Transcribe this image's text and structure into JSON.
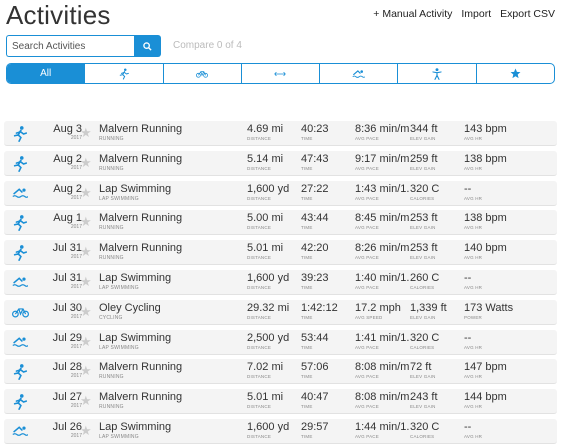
{
  "header": {
    "title": "Activities",
    "manual_activity": "+ Manual Activity",
    "import": "Import",
    "export": "Export CSV"
  },
  "search": {
    "placeholder": "Search Activities",
    "compare": "Compare 0 of 4"
  },
  "filters": [
    {
      "label": "All",
      "icon": "all"
    },
    {
      "label": "",
      "icon": "running-icon"
    },
    {
      "label": "",
      "icon": "cycling-icon"
    },
    {
      "label": "",
      "icon": "arrows-icon"
    },
    {
      "label": "",
      "icon": "swimming-icon"
    },
    {
      "label": "",
      "icon": "person-icon"
    },
    {
      "label": "",
      "icon": "star-icon"
    }
  ],
  "colors": {
    "accent": "#1a8fd6",
    "row_bg": "#f4f4f4",
    "star": "#cccccc"
  },
  "activities": [
    {
      "icon": "run",
      "date": "Aug 3",
      "year": "2017",
      "name": "Malvern Running",
      "type": "RUNNING",
      "m": [
        [
          "4.69 mi",
          "DISTANCE"
        ],
        [
          "40:23",
          "TIME"
        ],
        [
          "8:36 min/mi",
          "AVG PACE"
        ],
        [
          "344 ft",
          "ELEV GAIN"
        ],
        [
          "143 bpm",
          "AVG HR"
        ]
      ]
    },
    {
      "icon": "run",
      "date": "Aug 2",
      "year": "2017",
      "name": "Malvern Running",
      "type": "RUNNING",
      "m": [
        [
          "5.14 mi",
          "DISTANCE"
        ],
        [
          "47:43",
          "TIME"
        ],
        [
          "9:17 min/mi",
          "AVG PACE"
        ],
        [
          "259 ft",
          "ELEV GAIN"
        ],
        [
          "138 bpm",
          "AVG HR"
        ]
      ]
    },
    {
      "icon": "swim",
      "date": "Aug 2",
      "year": "2017",
      "name": "Lap Swimming",
      "type": "LAP SWIMMING",
      "m": [
        [
          "1,600 yd",
          "DISTANCE"
        ],
        [
          "27:22",
          "TIME"
        ],
        [
          "1:43 min/1...",
          "AVG PACE"
        ],
        [
          "320 C",
          "CALORIES"
        ],
        [
          "--",
          "AVG HR"
        ]
      ]
    },
    {
      "icon": "run",
      "date": "Aug 1",
      "year": "2017",
      "name": "Malvern Running",
      "type": "RUNNING",
      "m": [
        [
          "5.00 mi",
          "DISTANCE"
        ],
        [
          "43:44",
          "TIME"
        ],
        [
          "8:45 min/mi",
          "AVG PACE"
        ],
        [
          "253 ft",
          "ELEV GAIN"
        ],
        [
          "138 bpm",
          "AVG HR"
        ]
      ]
    },
    {
      "icon": "run",
      "date": "Jul 31",
      "year": "2017",
      "name": "Malvern Running",
      "type": "RUNNING",
      "m": [
        [
          "5.01 mi",
          "DISTANCE"
        ],
        [
          "42:20",
          "TIME"
        ],
        [
          "8:26 min/mi",
          "AVG PACE"
        ],
        [
          "253 ft",
          "ELEV GAIN"
        ],
        [
          "140 bpm",
          "AVG HR"
        ]
      ]
    },
    {
      "icon": "swim",
      "date": "Jul 31",
      "year": "2017",
      "name": "Lap Swimming",
      "type": "LAP SWIMMING",
      "m": [
        [
          "1,600 yd",
          "DISTANCE"
        ],
        [
          "39:23",
          "TIME"
        ],
        [
          "1:40 min/1...",
          "AVG PACE"
        ],
        [
          "260 C",
          "CALORIES"
        ],
        [
          "--",
          "AVG HR"
        ]
      ]
    },
    {
      "icon": "bike",
      "date": "Jul 30",
      "year": "2017",
      "name": "Oley Cycling",
      "type": "CYCLING",
      "m": [
        [
          "29.32 mi",
          "DISTANCE"
        ],
        [
          "1:42:12",
          "TIME"
        ],
        [
          "17.2 mph",
          "AVG SPEED"
        ],
        [
          "1,339 ft",
          "ELEV GAIN"
        ],
        [
          "173 Watts",
          "POWER"
        ]
      ]
    },
    {
      "icon": "swim",
      "date": "Jul 29",
      "year": "2017",
      "name": "Lap Swimming",
      "type": "LAP SWIMMING",
      "m": [
        [
          "2,500 yd",
          "DISTANCE"
        ],
        [
          "53:44",
          "TIME"
        ],
        [
          "1:41 min/1...",
          "AVG PACE"
        ],
        [
          "320 C",
          "CALORIES"
        ],
        [
          "--",
          "AVG HR"
        ]
      ]
    },
    {
      "icon": "run",
      "date": "Jul 28",
      "year": "2017",
      "name": "Malvern Running",
      "type": "RUNNING",
      "m": [
        [
          "7.02 mi",
          "DISTANCE"
        ],
        [
          "57:06",
          "TIME"
        ],
        [
          "8:08 min/mi",
          "AVG PACE"
        ],
        [
          "72 ft",
          "ELEV GAIN"
        ],
        [
          "147 bpm",
          "AVG HR"
        ]
      ]
    },
    {
      "icon": "run",
      "date": "Jul 27",
      "year": "2017",
      "name": "Malvern Running",
      "type": "RUNNING",
      "m": [
        [
          "5.01 mi",
          "DISTANCE"
        ],
        [
          "40:47",
          "TIME"
        ],
        [
          "8:08 min/mi",
          "AVG PACE"
        ],
        [
          "243 ft",
          "ELEV GAIN"
        ],
        [
          "144 bpm",
          "AVG HR"
        ]
      ]
    },
    {
      "icon": "swim",
      "date": "Jul 26",
      "year": "2017",
      "name": "Lap Swimming",
      "type": "LAP SWIMMING",
      "m": [
        [
          "1,600 yd",
          "DISTANCE"
        ],
        [
          "29:57",
          "TIME"
        ],
        [
          "1:44 min/1...",
          "AVG PACE"
        ],
        [
          "320 C",
          "CALORIES"
        ],
        [
          "--",
          "AVG HR"
        ]
      ]
    }
  ]
}
